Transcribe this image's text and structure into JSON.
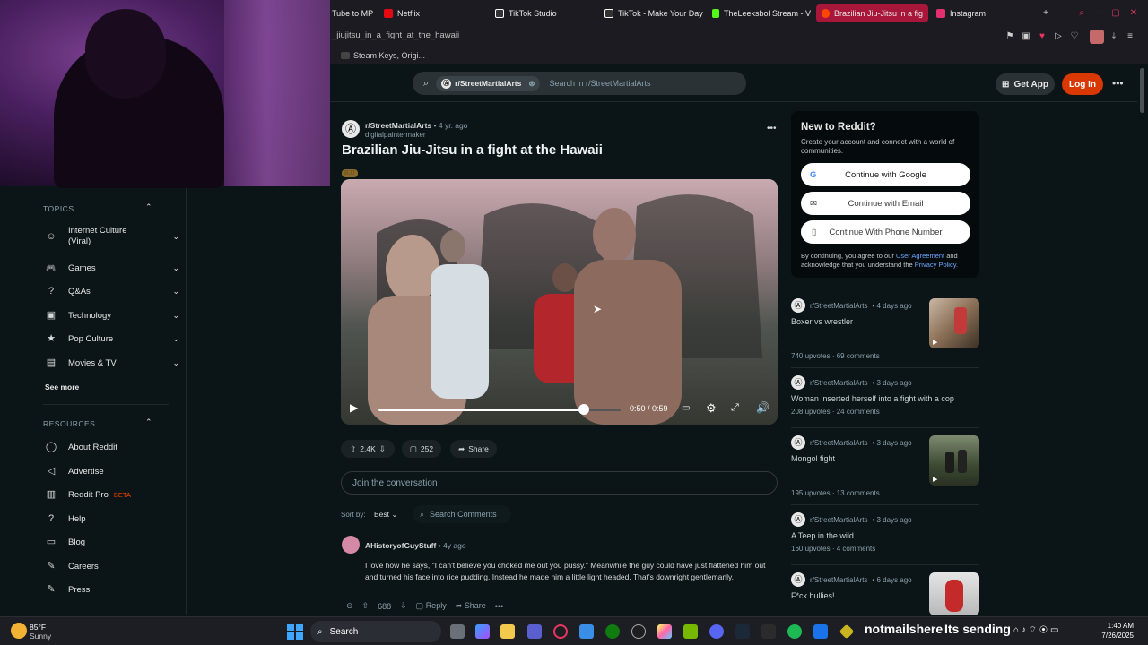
{
  "browser": {
    "tabs": [
      {
        "label": "Tube to MP",
        "color": "#e0e0e0"
      },
      {
        "label": "Netflix",
        "color": "#e50914"
      },
      {
        "label": "TikTok Studio",
        "color": "#ffffff"
      },
      {
        "label": "TikTok - Make Your Day",
        "color": "#ffffff"
      },
      {
        "label": "TheLeeksbol Stream - V",
        "color": "#53fc18"
      },
      {
        "label": "Brazilian Jiu-Jitsu in a fig",
        "color": "#ff4500"
      },
      {
        "label": "Instagram",
        "color": "#e1306c"
      }
    ],
    "url": "_jiujitsu_in_a_fight_at_the_hawaii",
    "bookmark": "Steam Keys, Origi..."
  },
  "header": {
    "subreddit_chip": "r/StreetMartialArts",
    "search_placeholder": "Search in r/StreetMartialArts",
    "get_app": "Get App",
    "login": "Log In"
  },
  "sidebar": {
    "topics_title": "TOPICS",
    "topics": [
      {
        "label": "Internet Culture (Viral)",
        "icon": "☺"
      },
      {
        "label": "Games",
        "icon": "🎮"
      },
      {
        "label": "Q&As",
        "icon": "?"
      },
      {
        "label": "Technology",
        "icon": "▣"
      },
      {
        "label": "Pop Culture",
        "icon": "★"
      },
      {
        "label": "Movies & TV",
        "icon": "▤"
      }
    ],
    "see_more": "See more",
    "resources_title": "RESOURCES",
    "resources": [
      {
        "label": "About Reddit",
        "icon": "◯"
      },
      {
        "label": "Advertise",
        "icon": "◁"
      },
      {
        "label": "Reddit Pro",
        "icon": "▥",
        "badge": "BETA"
      },
      {
        "label": "Help",
        "icon": "?"
      },
      {
        "label": "Blog",
        "icon": "▭"
      },
      {
        "label": "Careers",
        "icon": "✎"
      },
      {
        "label": "Press",
        "icon": "✎"
      }
    ]
  },
  "post": {
    "subreddit": "r/StreetMartialArts",
    "age": "• 4 yr. ago",
    "author": "digitalpaintermaker",
    "title": "Brazilian Jiu-Jitsu in a fight at the Hawaii",
    "flair": "BJJ",
    "video": {
      "time": "0:50 / 0:59",
      "progress": 0.848
    },
    "upvotes": "2.4K",
    "comments": "252",
    "share": "Share",
    "join_placeholder": "Join the conversation",
    "sort_label": "Sort by:",
    "sort_value": "Best",
    "search_comments": "Search Comments"
  },
  "comment": {
    "author": "AHistoryofGuyStuff",
    "age": "• 4y ago",
    "text": "I love how he says, \"I can't believe you choked me out you pussy.\" Meanwhile the guy could have just flattened him out and turned his face into rice pudding. Instead he made him a little light headed. That's downright gentlemanly.",
    "votes": "688",
    "reply": "Reply",
    "share": "Share"
  },
  "signup": {
    "title": "New to Reddit?",
    "subtitle": "Create your account and connect with a world of communities.",
    "google": "Continue with Google",
    "email": "Continue with Email",
    "phone": "Continue With Phone Number",
    "legal_prefix": "By continuing, you agree to our",
    "legal_link1": "User Agreement",
    "legal_mid": "and acknowledge that you understand the",
    "legal_link2": "Privacy Policy."
  },
  "related": [
    {
      "sub": "r/StreetMartialArts",
      "age": "• 4 days ago",
      "title": "Boxer vs wrestler",
      "stats": "740 upvotes · 69 comments"
    },
    {
      "sub": "r/StreetMartialArts",
      "age": "• 3 days ago",
      "title": "Woman inserted herself into a fight with a cop",
      "stats": "208 upvotes · 24 comments"
    },
    {
      "sub": "r/StreetMartialArts",
      "age": "• 3 days ago",
      "title": "Mongol fight",
      "stats": "195 upvotes · 13 comments"
    },
    {
      "sub": "r/StreetMartialArts",
      "age": "• 3 days ago",
      "title": "A Teep in the wild",
      "stats": "160 upvotes · 4 comments"
    },
    {
      "sub": "r/StreetMartialArts",
      "age": "• 6 days ago",
      "title": "F*ck bullies!",
      "stats": ""
    }
  ],
  "taskbar": {
    "weather_temp": "85°F",
    "weather_desc": "Sunny",
    "search": "Search",
    "overlay_name": "notmailshere",
    "overlay_status": "Its sending",
    "time": "1:40 AM",
    "date": "7/26/2025"
  }
}
